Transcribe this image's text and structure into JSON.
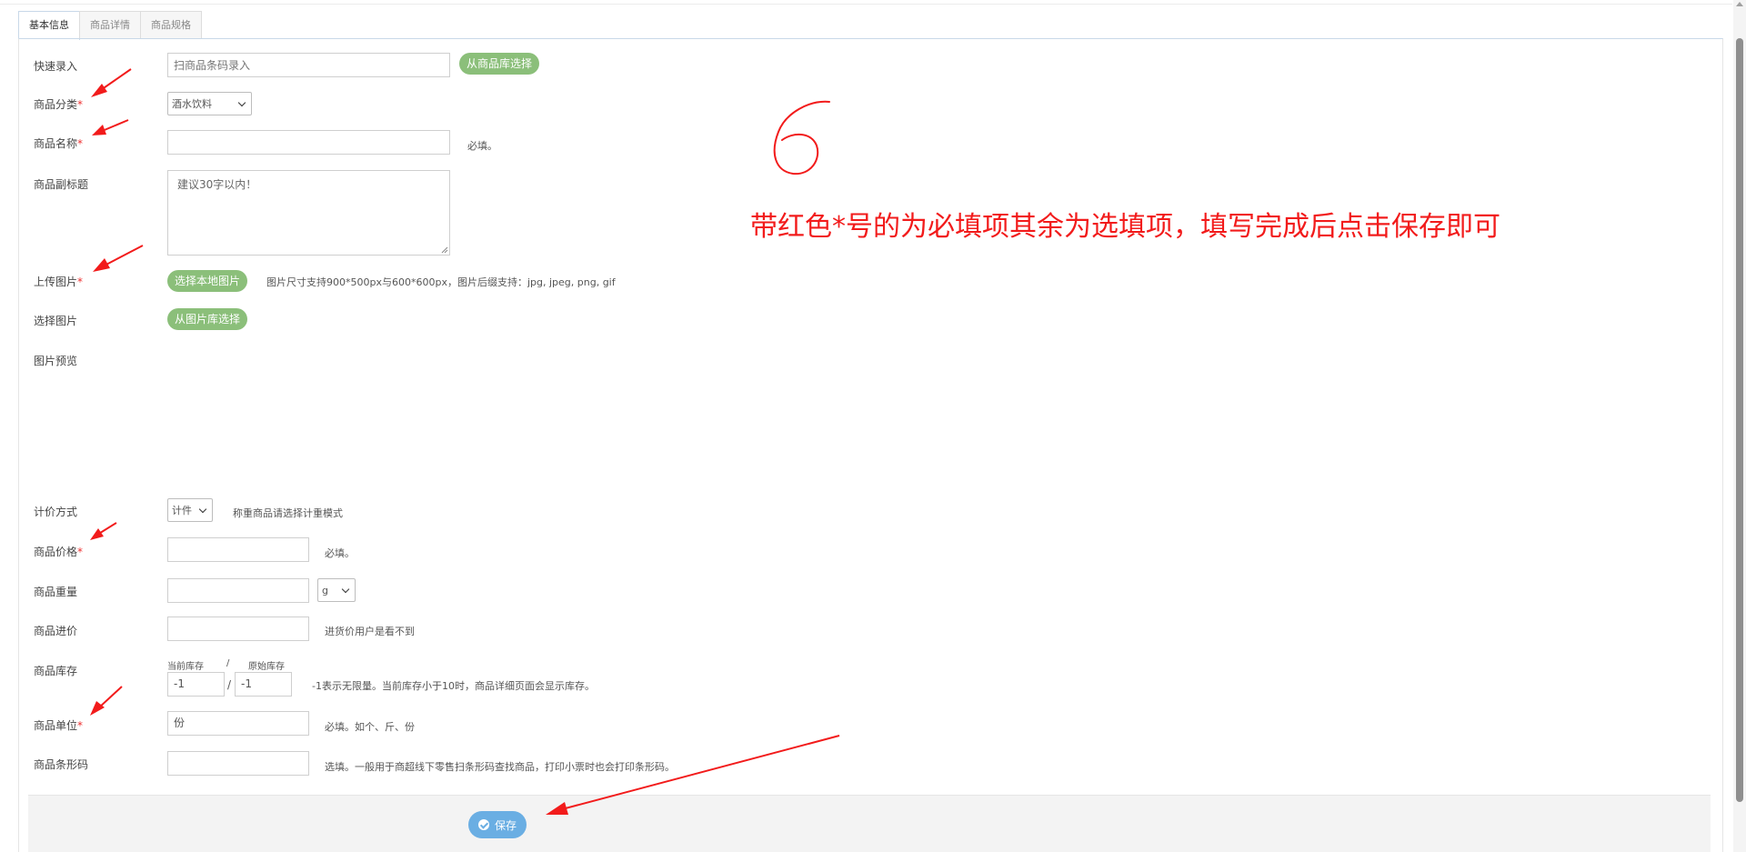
{
  "tabs": [
    {
      "label": "基本信息",
      "active": true
    },
    {
      "label": "商品详情",
      "active": false
    },
    {
      "label": "商品规格",
      "active": false
    }
  ],
  "form": {
    "quick_entry": {
      "label": "快速录入",
      "placeholder": "扫商品条码录入",
      "button": "从商品库选择"
    },
    "category": {
      "label": "商品分类",
      "required_mark": "*",
      "selected": "酒水饮料"
    },
    "name": {
      "label": "商品名称",
      "required_mark": "*",
      "value": "",
      "hint": "必填。"
    },
    "subtitle": {
      "label": "商品副标题",
      "placeholder": "建议30字以内！"
    },
    "upload": {
      "label": "上传图片",
      "required_mark": "*",
      "button": "选择本地图片",
      "hint": "图片尺寸支持900*500px与600*600px，图片后缀支持：jpg, jpeg, png, gif"
    },
    "choose_image": {
      "label": "选择图片",
      "button": "从图片库选择"
    },
    "preview": {
      "label": "图片预览"
    },
    "pricing_mode": {
      "label": "计价方式",
      "selected": "计件",
      "hint": "称重商品请选择计重模式"
    },
    "price": {
      "label": "商品价格",
      "required_mark": "*",
      "value": "",
      "hint": "必填。"
    },
    "weight": {
      "label": "商品重量",
      "value": "",
      "unit_selected": "g"
    },
    "cost": {
      "label": "商品进价",
      "value": "",
      "hint": "进货价用户是看不到"
    },
    "stock": {
      "label": "商品库存",
      "current_label": "当前库存",
      "separator": "/",
      "original_label": "原始库存",
      "current_value": "-1",
      "original_value": "-1",
      "hint": "-1表示无限量。当前库存小于10时，商品详细页面会显示库存。"
    },
    "unit": {
      "label": "商品单位",
      "required_mark": "*",
      "value": "份",
      "hint": "必填。如个、斤、份"
    },
    "barcode": {
      "label": "商品条形码",
      "value": "",
      "hint": "选填。一般用于商超线下零售扫条形码查找商品，打印小票时也会打印条形码。"
    }
  },
  "save_button": {
    "label": "保存",
    "icon": "check-circle-icon"
  },
  "annotation": {
    "digit": "6",
    "text": "带红色*号的为必填项其余为选填项，填写完成后点击保存即可",
    "color": "#f21b1b"
  },
  "colors": {
    "green_button": "#8bbf7a",
    "save_button": "#6aaee3",
    "required": "#ee3333"
  }
}
